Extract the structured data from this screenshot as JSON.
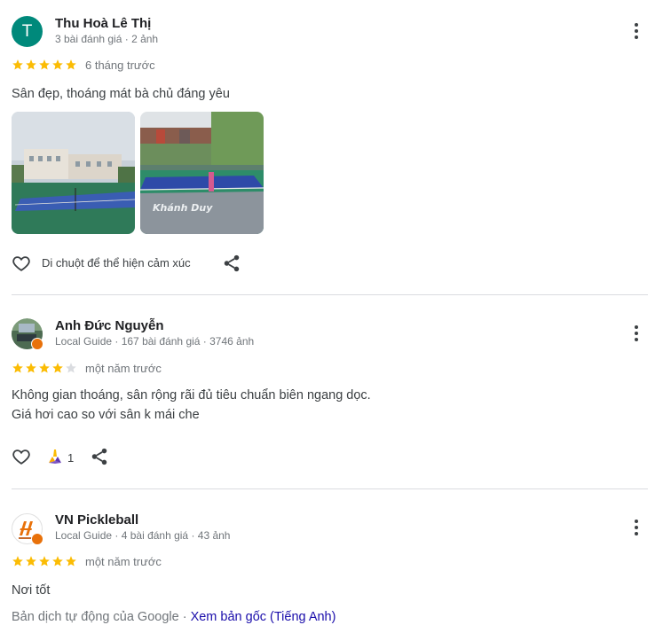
{
  "reviews": [
    {
      "avatar_letter": "T",
      "name": "Thu Hoà Lê Thị",
      "meta": "3 bài đánh giá · 2 ảnh",
      "rating": 5,
      "time": "6 tháng trước",
      "text": "Sân đẹp, thoáng mát bà chủ đáng yêu",
      "photo_caption": "Khánh Duy",
      "react_label": "Di chuột để thể hiện cảm xúc"
    },
    {
      "name": "Anh Đức Nguyễn",
      "meta": "Local Guide · 167 bài đánh giá · 3746 ảnh",
      "rating": 4,
      "time": "một năm trước",
      "text_line1": "Không gian thoáng, sân rộng rãi đủ tiêu chuẩn biên ngang dọc.",
      "text_line2": "Giá hơi cao so với sân k mái che",
      "reaction_count": "1"
    },
    {
      "name": "VN Pickleball",
      "meta": "Local Guide · 4 bài đánh giá · 43 ảnh",
      "rating": 5,
      "time": "một năm trước",
      "text": "Nơi tốt",
      "translate_prefix": "Bản dịch tự động của Google · ",
      "translate_link": "Xem bản gốc (Tiếng Anh)"
    }
  ],
  "colors": {
    "star": "#fbbc04",
    "star_empty": "#dadce0",
    "avatar": "#00897b",
    "link": "#1a0dab"
  }
}
